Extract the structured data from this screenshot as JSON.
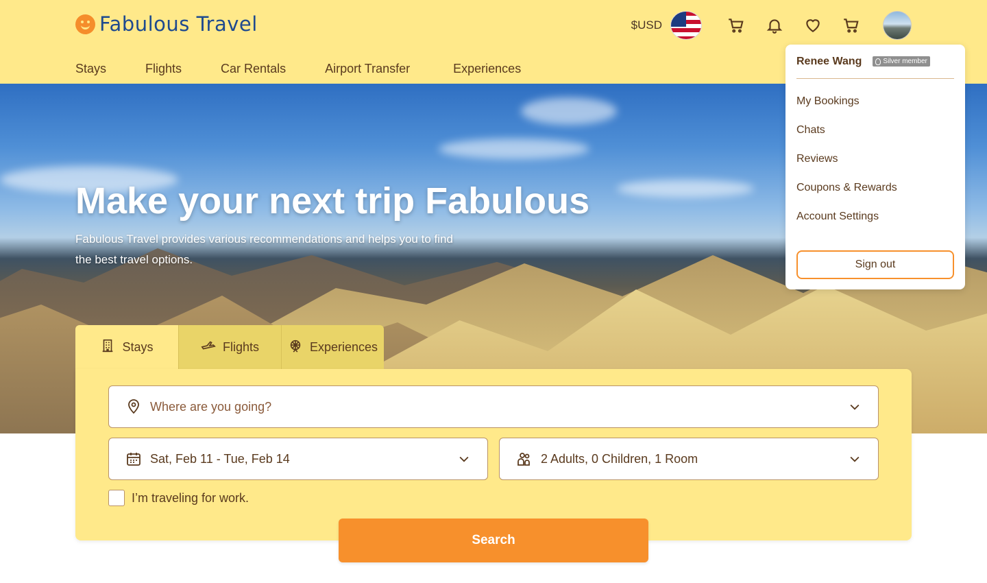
{
  "brand": {
    "name": "Fabulous Travel",
    "logo_color": "#1e4a8f",
    "accent": "#f58d2b"
  },
  "header": {
    "currency": "$USD",
    "flag_icon": "us-flag-icon",
    "icons": [
      "cart-icon",
      "bell-icon",
      "heart-icon",
      "cart-icon"
    ]
  },
  "nav": {
    "items": [
      "Stays",
      "Flights",
      "Car Rentals",
      "Airport Transfer",
      "Experiences"
    ]
  },
  "hero": {
    "title": "Make your next trip Fabulous",
    "subtitle": "Fabulous Travel provides various recommendations and helps you to find the best travel options."
  },
  "search": {
    "tabs": [
      {
        "label": "Stays",
        "icon": "building-icon",
        "active": true
      },
      {
        "label": "Flights",
        "icon": "plane-icon",
        "active": false
      },
      {
        "label": "Experiences",
        "icon": "ferris-wheel-icon",
        "active": false
      }
    ],
    "destination_placeholder": "Where are you going?",
    "dates": "Sat, Feb 11 - Tue, Feb 14",
    "guests": "2 Adults, 0 Children, 1 Room",
    "work_label": "I’m traveling for work.",
    "work_checked": false,
    "button": "Search"
  },
  "user_menu": {
    "name": "Renee Wang",
    "badge": "Silver member",
    "items": [
      "My Bookings",
      "Chats",
      "Reviews",
      "Coupons & Rewards",
      "Account Settings"
    ],
    "sign_out": "Sign out"
  },
  "colors": {
    "header_bg": "#ffe98a",
    "primary_button": "#f7902c",
    "text": "#5a3a1e"
  }
}
